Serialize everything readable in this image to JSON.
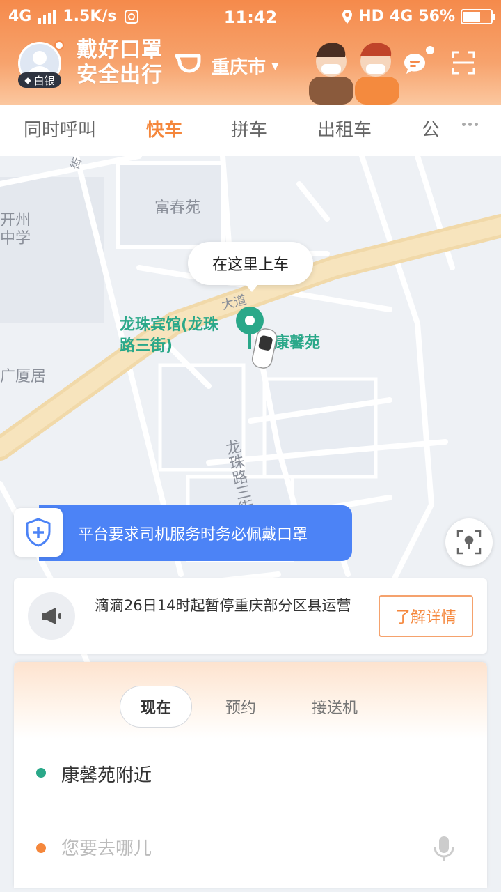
{
  "status_bar": {
    "network": "4G",
    "speed": "1.5K/s",
    "time": "11:42",
    "hd": "HD",
    "network2": "4G",
    "battery": "56%",
    "battery_level": 0.56
  },
  "header": {
    "badge": "白银",
    "slogan_line1": "戴好口罩",
    "slogan_line2": "安全出行",
    "city": "重庆市",
    "accent_color": "#f58a4b"
  },
  "tabs": [
    "同时呼叫",
    "快车",
    "拼车",
    "出租车",
    "公"
  ],
  "active_tab": "快车",
  "map": {
    "labels": {
      "fuchunyuan": "富春苑",
      "kaizhou_1": "开州",
      "kaizhou_2": "中学",
      "guangxia": "广厦居",
      "longzhu_road": "龙珠路三街",
      "dadao": "大道",
      "jie": "街"
    },
    "pickup_bubble": "在这里上车",
    "poi_hotel_line1": "龙珠宾馆(龙珠",
    "poi_hotel_line2": "路三街)",
    "poi_kangxin": "康馨苑"
  },
  "mask_banner": "平台要求司机服务时务必佩戴口罩",
  "notice": {
    "text": "滴滴26日14时起暂停重庆部分区县运营",
    "button": "了解详情"
  },
  "booking": {
    "modes": [
      "现在",
      "预约",
      "接送机"
    ],
    "active_mode": "现在",
    "from": "康馨苑附近",
    "to_placeholder": "您要去哪儿"
  }
}
